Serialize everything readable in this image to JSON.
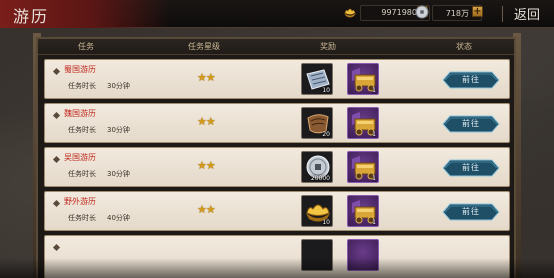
{
  "header": {
    "title": "游历",
    "gold_value": "9971980",
    "silver_value": "718万",
    "back_label": "返回"
  },
  "columns": [
    "任务",
    "任务星级",
    "奖励",
    "状态"
  ],
  "rows": [
    {
      "name": "蜀国游历",
      "duration_label": "任务时长",
      "duration_value": "30分钟",
      "stars": "★★",
      "rewards": [
        {
          "icon": "silver-ticket-icon",
          "count": "10"
        },
        {
          "icon": "gold-cart-icon",
          "count": "1"
        }
      ],
      "action": "前往"
    },
    {
      "name": "魏国游历",
      "duration_label": "任务时长",
      "duration_value": "30分钟",
      "stars": "★★",
      "rewards": [
        {
          "icon": "scroll-icon",
          "count": "20"
        },
        {
          "icon": "gold-cart-icon",
          "count": "1"
        }
      ],
      "action": "前往"
    },
    {
      "name": "吴国游历",
      "duration_label": "任务时长",
      "duration_value": "30分钟",
      "stars": "★★",
      "rewards": [
        {
          "icon": "silver-coin-icon",
          "count": "20000"
        },
        {
          "icon": "gold-cart-icon",
          "count": "1"
        }
      ],
      "action": "前往"
    },
    {
      "name": "野外游历",
      "duration_label": "任务时长",
      "duration_value": "40分钟",
      "stars": "★★",
      "rewards": [
        {
          "icon": "gold-ingot-icon",
          "count": "10"
        },
        {
          "icon": "gold-cart-icon",
          "count": "1"
        }
      ],
      "action": "前往"
    }
  ]
}
